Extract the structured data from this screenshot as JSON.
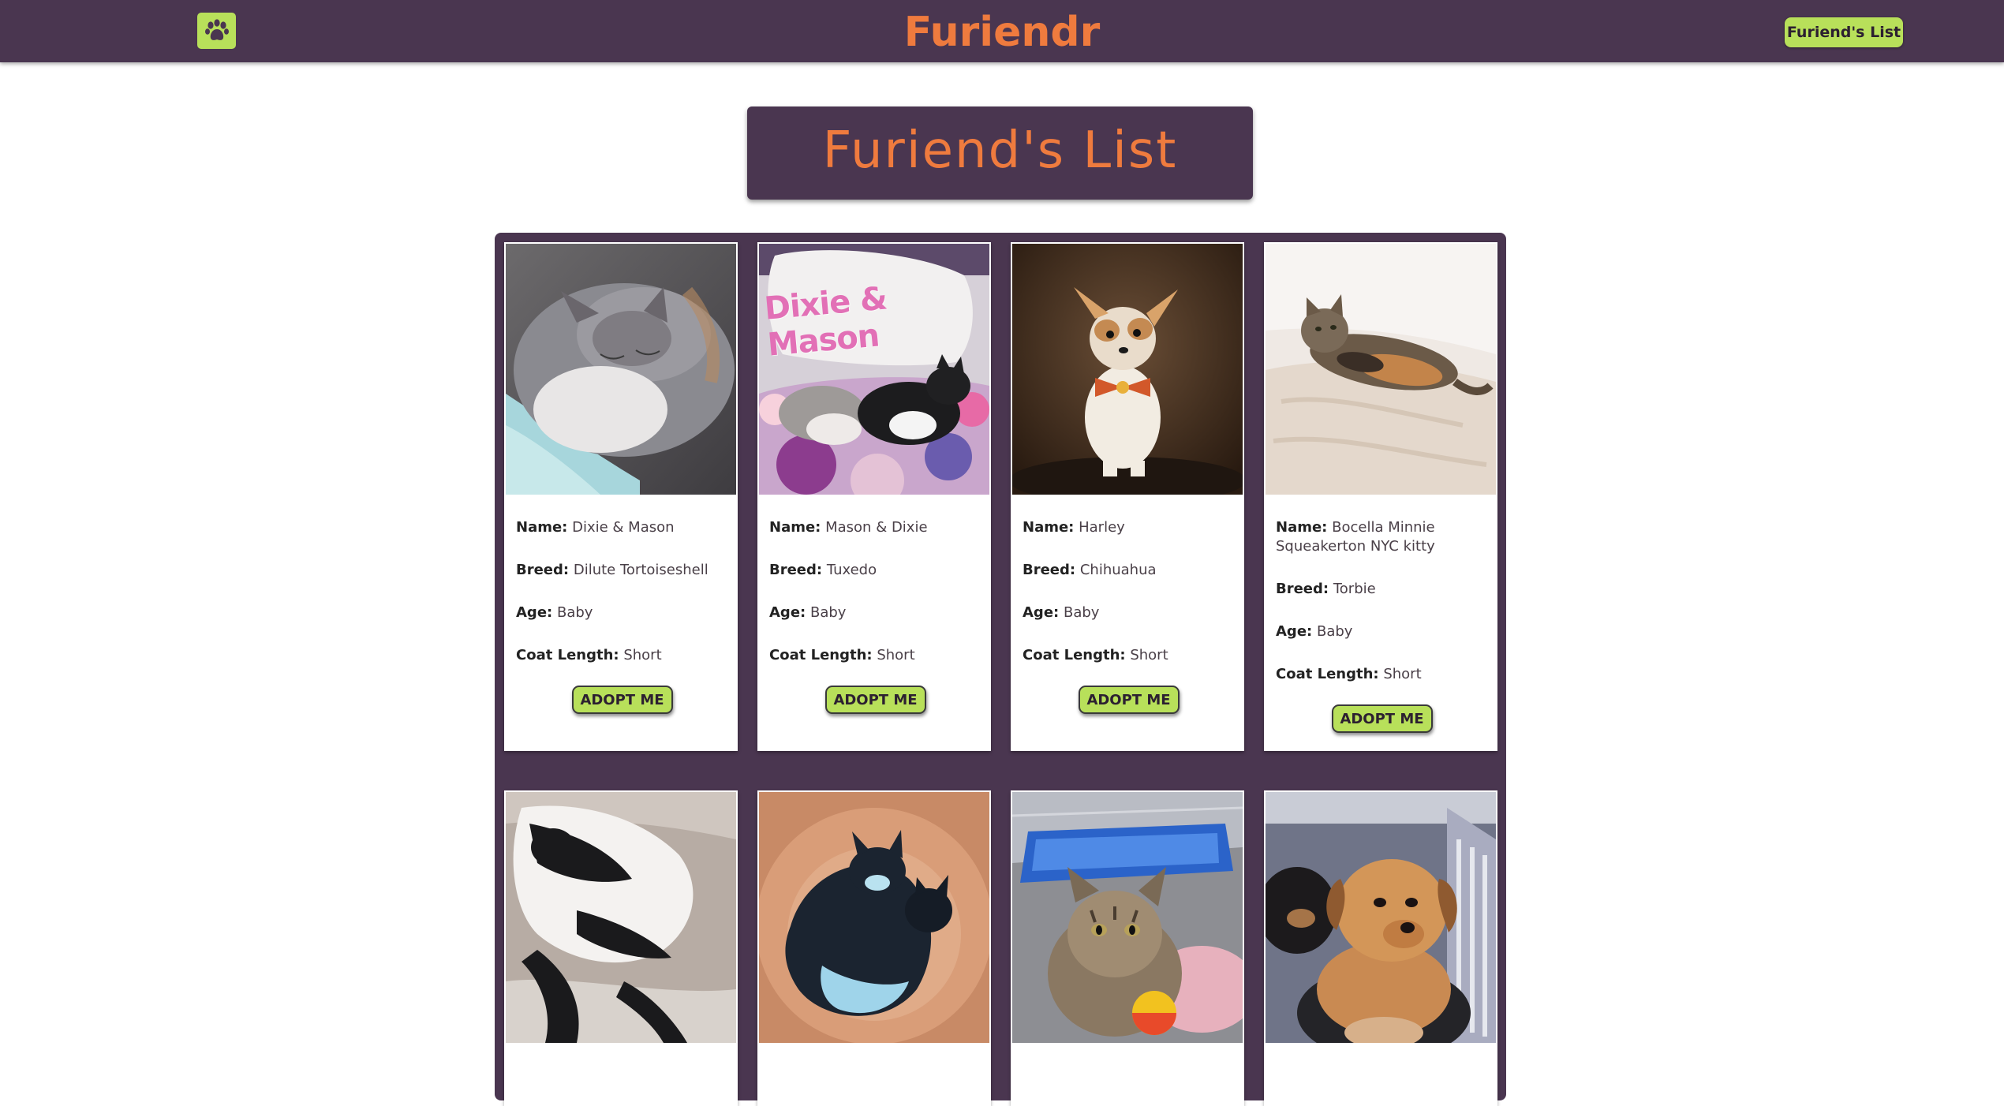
{
  "brand": {
    "name": "Furiendr",
    "logo_icon": "paw-icon"
  },
  "nav": {
    "list_button": "Furiend's List"
  },
  "page": {
    "title": "Furiend's List"
  },
  "labels": {
    "name": "Name:",
    "breed": "Breed:",
    "age": "Age:",
    "coat": "Coat Length:",
    "adopt": "ADOPT ME"
  },
  "colors": {
    "primary": "#4a3650",
    "accent": "#ef7b3e",
    "button": "#b8e05a"
  },
  "pets": [
    {
      "name": "Dixie & Mason",
      "breed": "Dilute Tortoiseshell",
      "age": "Baby",
      "coat": "Short",
      "photo": "gray-cat-sleeping-photo"
    },
    {
      "name": "Mason & Dixie",
      "breed": "Tuxedo",
      "age": "Baby",
      "coat": "Short",
      "photo": "two-cats-on-pillow-photo",
      "caption": "Dixie & Mason"
    },
    {
      "name": "Harley",
      "breed": "Chihuahua",
      "age": "Baby",
      "coat": "Short",
      "photo": "chihuahua-bowtie-photo"
    },
    {
      "name": "Bocella Minnie Squeakerton NYC kitty",
      "breed": "Torbie",
      "age": "Baby",
      "coat": "Short",
      "photo": "torbie-cat-on-bed-photo"
    },
    {
      "photo": "tuxedo-cat-on-blanket-photo"
    },
    {
      "photo": "two-tuxedo-cats-photo"
    },
    {
      "photo": "tabby-kitten-with-ball-photo"
    },
    {
      "photo": "puppy-in-crate-photo"
    }
  ]
}
